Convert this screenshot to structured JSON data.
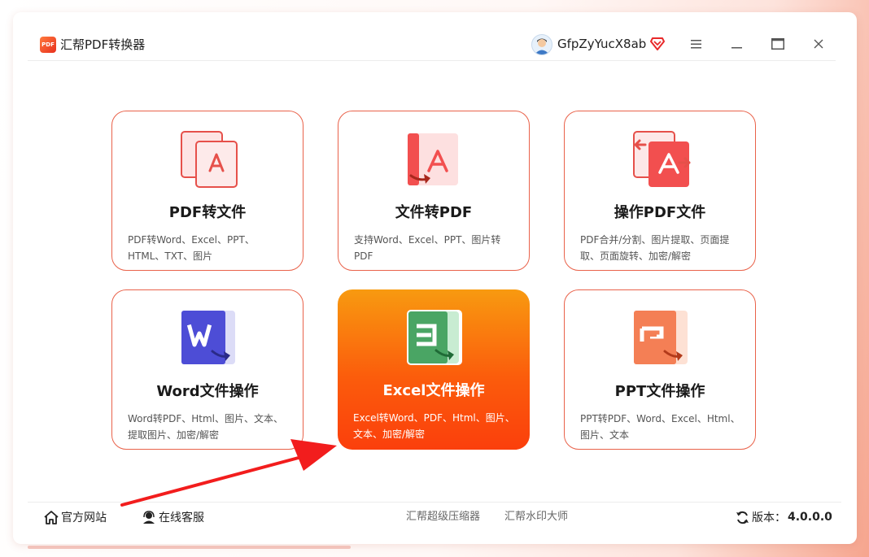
{
  "app": {
    "logo_text": "PDF",
    "title": "汇帮PDF转换器"
  },
  "user": {
    "name": "GfpZyYucX8ab"
  },
  "cards": [
    {
      "title": "PDF转文件",
      "desc": "PDF转Word、Excel、PPT、HTML、TXT、图片"
    },
    {
      "title": "文件转PDF",
      "desc": "支持Word、Excel、PPT、图片转PDF"
    },
    {
      "title": "操作PDF文件",
      "desc": "PDF合并/分割、图片提取、页面提取、页面旋转、加密/解密"
    },
    {
      "title": "Word文件操作",
      "desc": "Word转PDF、Html、图片、文本、提取图片、加密/解密"
    },
    {
      "title": "Excel文件操作",
      "desc": "Excel转Word、PDF、Html、图片、文本、加密/解密"
    },
    {
      "title": "PPT文件操作",
      "desc": "PPT转PDF、Word、Excel、Html、图片、文本"
    }
  ],
  "footer": {
    "website": "官方网站",
    "support": "在线客服",
    "app1": "汇帮超级压缩器",
    "app2": "汇帮水印大师",
    "version_label": "版本：",
    "version": "4.0.0.0"
  },
  "colors": {
    "accent": "#f25a3c",
    "active_start": "#f89a10",
    "active_end": "#fb3f0c"
  }
}
